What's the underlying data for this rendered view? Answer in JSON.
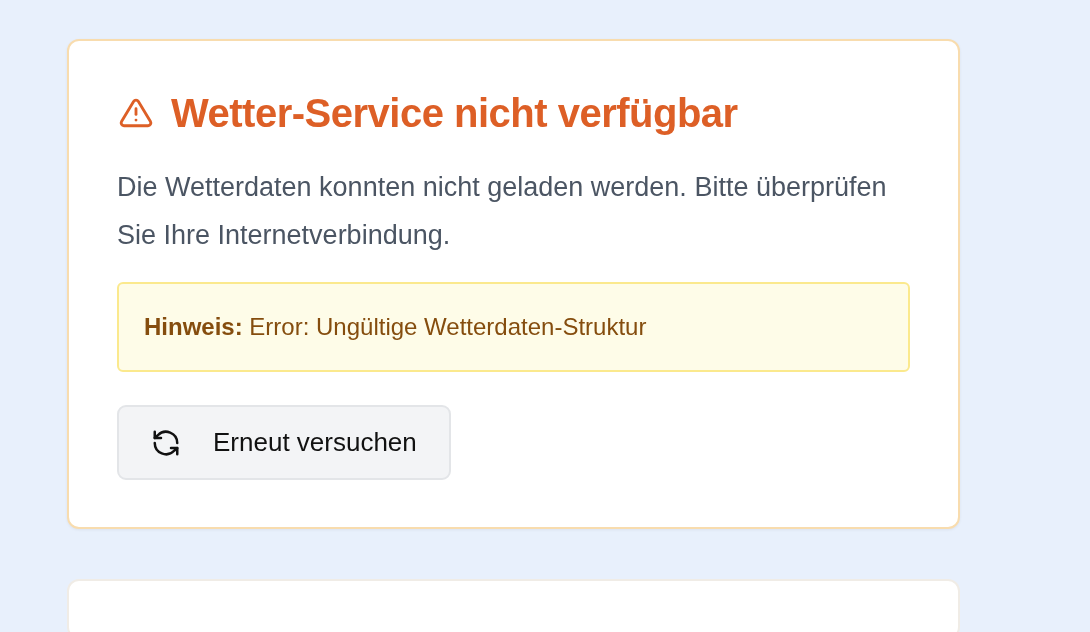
{
  "error_card": {
    "title": "Wetter-Service nicht verfügbar",
    "message": "Die Wetterdaten konnten nicht geladen werden. Bitte überprüfen Sie Ihre Internetverbindung.",
    "hint": "**Hinweis:** Error: Ungültige Wetterdaten-Struktur",
    "retry_button": "Erneut versuchen"
  }
}
